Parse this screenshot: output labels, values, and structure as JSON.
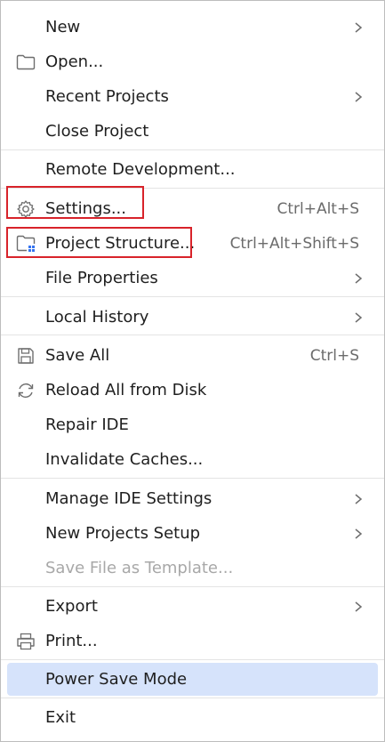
{
  "menu": {
    "new": "New",
    "open": "Open...",
    "recent_projects": "Recent Projects",
    "close_project": "Close Project",
    "remote_development": "Remote Development...",
    "settings": "Settings...",
    "settings_shortcut": "Ctrl+Alt+S",
    "project_structure": "Project Structure...",
    "project_structure_shortcut": "Ctrl+Alt+Shift+S",
    "file_properties": "File Properties",
    "local_history": "Local History",
    "save_all": "Save All",
    "save_all_shortcut": "Ctrl+S",
    "reload_all": "Reload All from Disk",
    "repair_ide": "Repair IDE",
    "invalidate_caches": "Invalidate Caches...",
    "manage_ide_settings": "Manage IDE Settings",
    "new_projects_setup": "New Projects Setup",
    "save_as_template": "Save File as Template...",
    "export": "Export",
    "print": "Print...",
    "power_save_mode": "Power Save Mode",
    "exit": "Exit"
  },
  "colors": {
    "highlight_border": "#d8232a",
    "selected_bg": "#d6e3fb",
    "separator": "#e4e4e4",
    "shortcut_text": "#6b6b6b",
    "disabled_text": "#a8a8a8"
  }
}
